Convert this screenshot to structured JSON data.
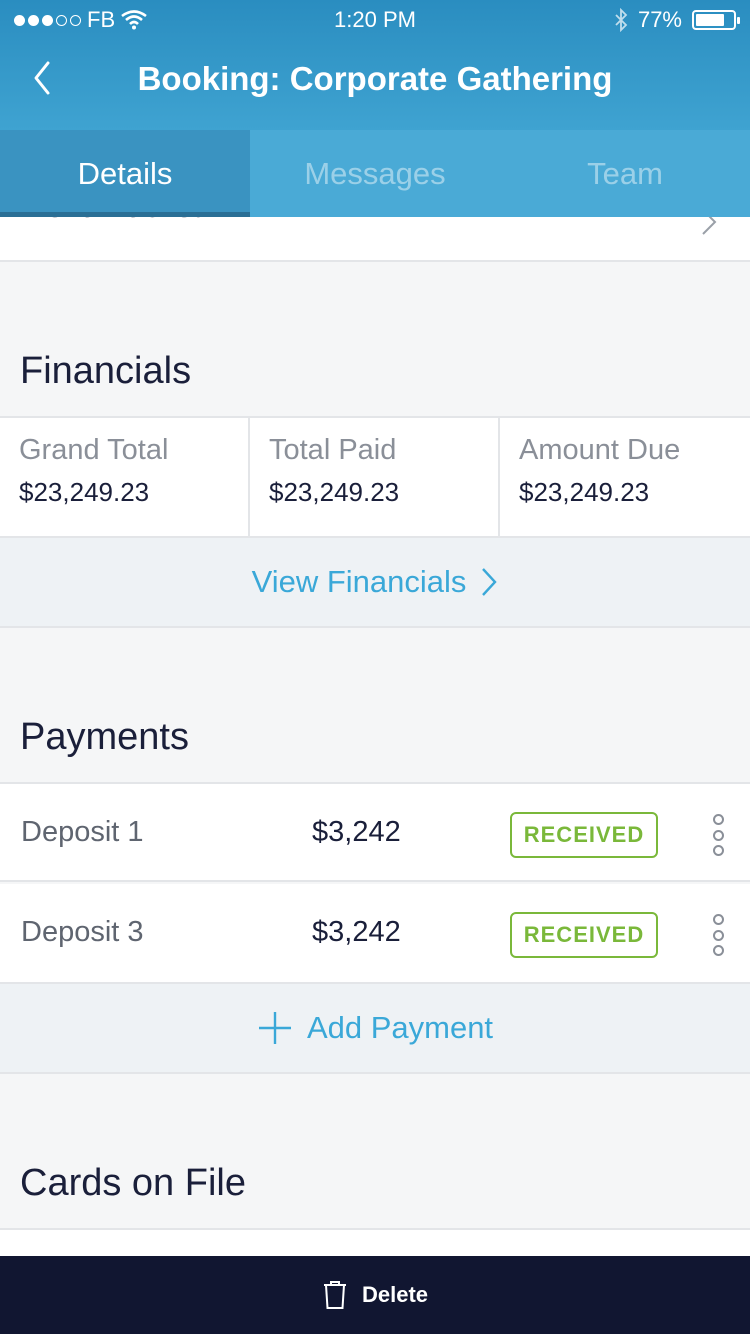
{
  "status_bar": {
    "carrier": "FB",
    "time": "1:20 PM",
    "battery_percent": "77%",
    "battery_level": 0.77
  },
  "nav": {
    "title": "Booking: Corporate Gathering"
  },
  "tabs": [
    {
      "label": "Details",
      "active": true
    },
    {
      "label": "Messages",
      "active": false
    },
    {
      "label": "Team",
      "active": false
    }
  ],
  "partial_row": {
    "label": "Menu Packet"
  },
  "financials": {
    "title": "Financials",
    "cells": [
      {
        "label": "Grand Total",
        "value": "$23,249.23"
      },
      {
        "label": "Total Paid",
        "value": "$23,249.23"
      },
      {
        "label": "Amount Due",
        "value": "$23,249.23"
      }
    ],
    "action_label": "View Financials"
  },
  "payments": {
    "title": "Payments",
    "rows": [
      {
        "name": "Deposit 1",
        "amount": "$3,242",
        "status": "RECEIVED"
      },
      {
        "name": "Deposit 3",
        "amount": "$3,242",
        "status": "RECEIVED"
      }
    ],
    "add_label": "Add Payment"
  },
  "cards": {
    "title": "Cards on File"
  },
  "bottom": {
    "delete_label": "Delete"
  },
  "colors": {
    "header": "#2a8dc0",
    "accent": "#3aa8d8",
    "received": "#7ab83a",
    "bottom_bar": "#111631"
  }
}
